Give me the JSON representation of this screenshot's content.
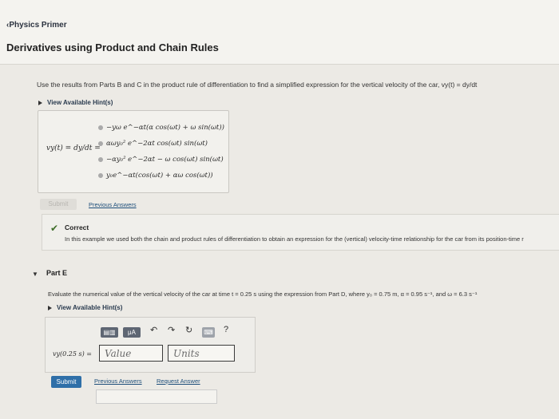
{
  "header": {
    "back_label": "Physics Primer",
    "title": "Derivatives using Product and Chain Rules"
  },
  "part_d": {
    "prompt": "Use the results from Parts B and C in the product rule of differentiation to find a simplified expression for the vertical velocity of the car, vy(t) = dy/dt",
    "hints_label": "View Available Hint(s)",
    "lhs": "vy(t) = dy/dt =",
    "choices": [
      "−yω e^−αt(α cos(ωt) + ω sin(ωt))",
      "αωy₀² e^−2αt cos(ωt) sin(ωt)",
      "−αy₀² e^−2αt − ω cos(ωt) sin(ωt)",
      "y₀e^−αt(cos(ωt) + αω cos(ωt))"
    ],
    "submit_label": "Submit",
    "previous_answers": "Previous Answers"
  },
  "correct": {
    "label": "Correct",
    "text": "In this example we used both the chain and product rules of differentiation to obtain an expression for the (vertical) velocity-time relationship for the car from its position-time r"
  },
  "part_e": {
    "heading": "Part E",
    "prompt": "Evaluate the numerical value of the vertical velocity of the car at time t = 0.25 s using the expression from Part D, where y₀ = 0.75 m, α = 0.95 s⁻¹, and ω = 6.3 s⁻¹",
    "hints_label": "View Available Hint(s)",
    "toolbar": [
      "μA",
      "↶",
      "↷",
      "↻",
      "?"
    ],
    "lhs": "vy(0.25 s) =",
    "value_placeholder": "Value",
    "units_placeholder": "Units",
    "submit_label": "Submit",
    "previous_answers": "Previous Answers",
    "request_answer": "Request Answer"
  }
}
